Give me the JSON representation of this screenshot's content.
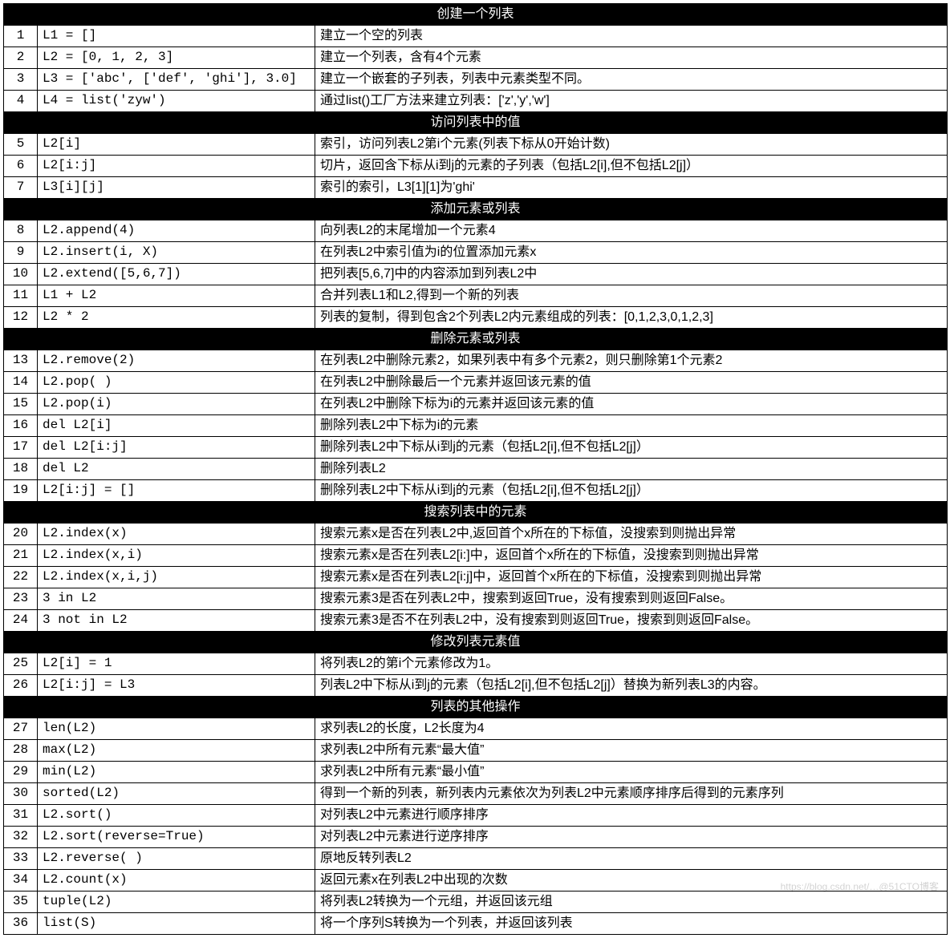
{
  "watermark": "https://blog.csdn.net/…@51CTO博客",
  "sections": [
    {
      "title": "创建一个列表",
      "rows": [
        {
          "n": "1",
          "code": "L1 = []",
          "desc": "建立一个空的列表"
        },
        {
          "n": "2",
          "code": "L2 = [0, 1, 2, 3]",
          "desc": "建立一个列表，含有4个元素"
        },
        {
          "n": "3",
          "code": "L3 = ['abc', ['def', 'ghi'], 3.0]",
          "desc": "建立一个嵌套的子列表，列表中元素类型不同。"
        },
        {
          "n": "4",
          "code": "L4 = list('zyw')",
          "desc": "通过list()工厂方法来建立列表：['z','y','w']"
        }
      ]
    },
    {
      "title": "访问列表中的值",
      "rows": [
        {
          "n": "5",
          "code": "L2[i]",
          "desc": "索引，访问列表L2第i个元素(列表下标从0开始计数)"
        },
        {
          "n": "6",
          "code": "L2[i:j]",
          "desc": "切片，返回含下标从i到j的元素的子列表（包括L2[i],但不包括L2[j]）"
        },
        {
          "n": "7",
          "code": "L3[i][j]",
          "desc": "索引的索引，L3[1][1]为'ghi'"
        }
      ]
    },
    {
      "title": "添加元素或列表",
      "rows": [
        {
          "n": "8",
          "code": "L2.append(4)",
          "desc": "向列表L2的末尾增加一个元素4"
        },
        {
          "n": "9",
          "code": "L2.insert(i, X)",
          "desc": "在列表L2中索引值为i的位置添加元素x"
        },
        {
          "n": "10",
          "code": "L2.extend([5,6,7])",
          "desc": "把列表[5,6,7]中的内容添加到列表L2中"
        },
        {
          "n": "11",
          "code": "L1 + L2",
          "desc": "合并列表L1和L2,得到一个新的列表"
        },
        {
          "n": "12",
          "code": "L2 * 2",
          "desc": "列表的复制，得到包含2个列表L2内元素组成的列表：[0,1,2,3,0,1,2,3]"
        }
      ]
    },
    {
      "title": "删除元素或列表",
      "rows": [
        {
          "n": "13",
          "code": "L2.remove(2)",
          "desc": "在列表L2中删除元素2，如果列表中有多个元素2，则只删除第1个元素2"
        },
        {
          "n": "14",
          "code": "L2.pop( )",
          "desc": "在列表L2中删除最后一个元素并返回该元素的值"
        },
        {
          "n": "15",
          "code": "L2.pop(i)",
          "desc": "在列表L2中删除下标为i的元素并返回该元素的值"
        },
        {
          "n": "16",
          "code": "del L2[i]",
          "desc": "删除列表L2中下标为i的元素"
        },
        {
          "n": "17",
          "code": "del L2[i:j]",
          "desc": "删除列表L2中下标从i到j的元素（包括L2[i],但不包括L2[j]）"
        },
        {
          "n": "18",
          "code": "del L2",
          "desc": "删除列表L2"
        },
        {
          "n": "19",
          "code": "L2[i:j] = []",
          "desc": "删除列表L2中下标从i到j的元素（包括L2[i],但不包括L2[j]）"
        }
      ]
    },
    {
      "title": "搜索列表中的元素",
      "rows": [
        {
          "n": "20",
          "code": "L2.index(x)",
          "desc": "搜索元素x是否在列表L2中,返回首个x所在的下标值，没搜索到则抛出异常"
        },
        {
          "n": "21",
          "code": "L2.index(x,i)",
          "desc": "搜索元素x是否在列表L2[i:]中，返回首个x所在的下标值，没搜索到则抛出异常"
        },
        {
          "n": "22",
          "code": "L2.index(x,i,j)",
          "desc": "搜索元素x是否在列表L2[i:j]中，返回首个x所在的下标值，没搜索到则抛出异常"
        },
        {
          "n": "23",
          "code": "3 in L2",
          "desc": "搜索元素3是否在列表L2中，搜索到返回True，没有搜索到则返回False。"
        },
        {
          "n": "24",
          "code": "3 not in L2",
          "desc": "搜索元素3是否不在列表L2中，没有搜索到则返回True，搜索到则返回False。"
        }
      ]
    },
    {
      "title": "修改列表元素值",
      "rows": [
        {
          "n": "25",
          "code": "L2[i] = 1",
          "desc": "将列表L2的第i个元素修改为1。"
        },
        {
          "n": "26",
          "code": "L2[i:j] = L3",
          "desc": "列表L2中下标从i到j的元素（包括L2[i],但不包括L2[j]）替换为新列表L3的内容。"
        }
      ]
    },
    {
      "title": "列表的其他操作",
      "rows": [
        {
          "n": "27",
          "code": "len(L2)",
          "desc": "求列表L2的长度，L2长度为4"
        },
        {
          "n": "28",
          "code": "max(L2)",
          "desc": "求列表L2中所有元素“最大值”"
        },
        {
          "n": "29",
          "code": "min(L2)",
          "desc": "求列表L2中所有元素“最小值”"
        },
        {
          "n": "30",
          "code": "sorted(L2)",
          "desc": "得到一个新的列表，新列表内元素依次为列表L2中元素顺序排序后得到的元素序列"
        },
        {
          "n": "31",
          "code": "L2.sort()",
          "desc": "对列表L2中元素进行顺序排序"
        },
        {
          "n": "32",
          "code": "L2.sort(reverse=True)",
          "desc": "对列表L2中元素进行逆序排序"
        },
        {
          "n": "33",
          "code": "L2.reverse( )",
          "desc": "原地反转列表L2"
        },
        {
          "n": "34",
          "code": "L2.count(x)",
          "desc": "返回元素x在列表L2中出现的次数"
        },
        {
          "n": "35",
          "code": "tuple(L2)",
          "desc": "将列表L2转换为一个元组，并返回该元组"
        },
        {
          "n": "36",
          "code": "list(S)",
          "desc": "将一个序列S转换为一个列表，并返回该列表"
        }
      ]
    }
  ]
}
